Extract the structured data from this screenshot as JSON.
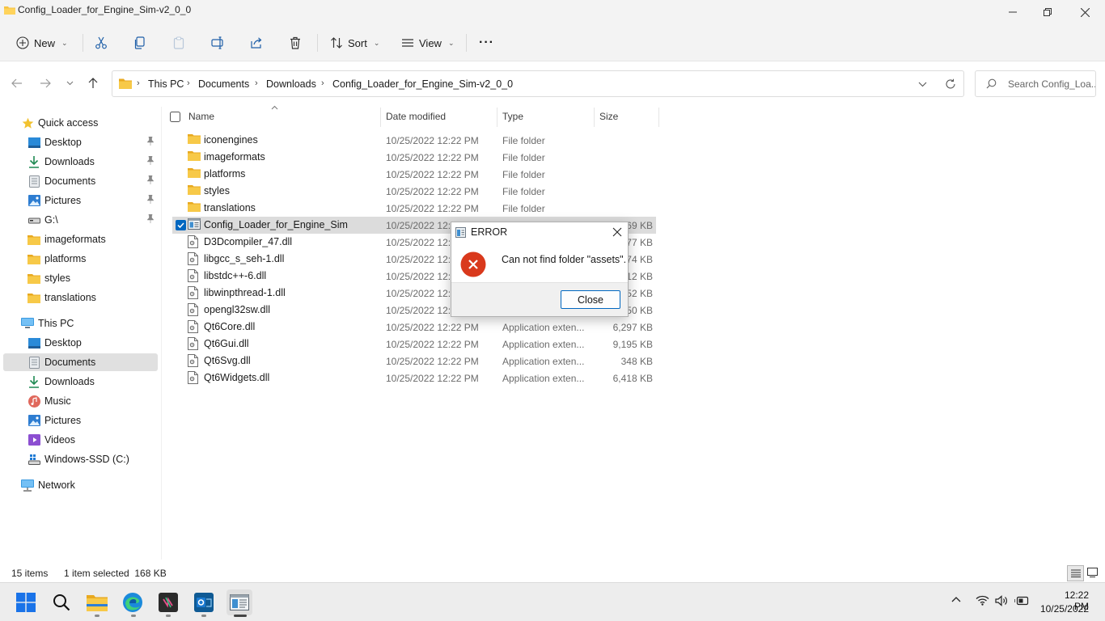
{
  "window": {
    "title": "Config_Loader_for_Engine_Sim-v2_0_0"
  },
  "toolbar": {
    "new_label": "New",
    "sort_label": "Sort",
    "view_label": "View",
    "more_label": "···"
  },
  "address": {
    "crumbs": [
      "This PC",
      "Documents",
      "Downloads",
      "Config_Loader_for_Engine_Sim-v2_0_0"
    ],
    "search_placeholder": "Search Config_Loa..."
  },
  "sidebar": {
    "quick_access": "Quick access",
    "quick_items": [
      {
        "label": "Desktop",
        "icon": "desktop-icon",
        "pinned": true
      },
      {
        "label": "Downloads",
        "icon": "download-icon",
        "pinned": true
      },
      {
        "label": "Documents",
        "icon": "document-icon",
        "pinned": true
      },
      {
        "label": "Pictures",
        "icon": "pictures-icon",
        "pinned": true
      },
      {
        "label": "G:\\",
        "icon": "drive-icon",
        "pinned": true
      },
      {
        "label": "imageformats",
        "icon": "folder-icon",
        "pinned": false
      },
      {
        "label": "platforms",
        "icon": "folder-icon",
        "pinned": false
      },
      {
        "label": "styles",
        "icon": "folder-icon",
        "pinned": false
      },
      {
        "label": "translations",
        "icon": "folder-icon",
        "pinned": false
      }
    ],
    "this_pc": "This PC",
    "pc_items": [
      {
        "label": "Desktop",
        "icon": "desktop-icon"
      },
      {
        "label": "Documents",
        "icon": "document-icon",
        "selected": true
      },
      {
        "label": "Downloads",
        "icon": "download-icon"
      },
      {
        "label": "Music",
        "icon": "music-icon"
      },
      {
        "label": "Pictures",
        "icon": "pictures-icon"
      },
      {
        "label": "Videos",
        "icon": "videos-icon"
      },
      {
        "label": "Windows-SSD (C:)",
        "icon": "drive-icon"
      }
    ],
    "network": "Network"
  },
  "columns": {
    "name": "Name",
    "date": "Date modified",
    "type": "Type",
    "size": "Size"
  },
  "files": [
    {
      "name": "iconengines",
      "date": "10/25/2022 12:22 PM",
      "type": "File folder",
      "size": "",
      "kind": "folder"
    },
    {
      "name": "imageformats",
      "date": "10/25/2022 12:22 PM",
      "type": "File folder",
      "size": "",
      "kind": "folder"
    },
    {
      "name": "platforms",
      "date": "10/25/2022 12:22 PM",
      "type": "File folder",
      "size": "",
      "kind": "folder"
    },
    {
      "name": "styles",
      "date": "10/25/2022 12:22 PM",
      "type": "File folder",
      "size": "",
      "kind": "folder"
    },
    {
      "name": "translations",
      "date": "10/25/2022 12:22 PM",
      "type": "File folder",
      "size": "",
      "kind": "folder"
    },
    {
      "name": "Config_Loader_for_Engine_Sim",
      "date": "10/25/2022 12:22 PM",
      "type": "Application",
      "size": "169 KB",
      "kind": "exe",
      "selected": true
    },
    {
      "name": "D3Dcompiler_47.dll",
      "date": "10/25/2022 12:22 PM",
      "type": "Application exten...",
      "size": "4,077 KB",
      "kind": "dll"
    },
    {
      "name": "libgcc_s_seh-1.dll",
      "date": "10/25/2022 12:22 PM",
      "type": "Application exten...",
      "size": "74 KB",
      "kind": "dll"
    },
    {
      "name": "libstdc++-6.dll",
      "date": "10/25/2022 12:22 PM",
      "type": "Application exten...",
      "size": "2,212 KB",
      "kind": "dll"
    },
    {
      "name": "libwinpthread-1.dll",
      "date": "10/25/2022 12:22 PM",
      "type": "Application exten...",
      "size": "52 KB",
      "kind": "dll"
    },
    {
      "name": "opengl32sw.dll",
      "date": "10/25/2022 12:22 PM",
      "type": "Application exten...",
      "size": "20,150 KB",
      "kind": "dll"
    },
    {
      "name": "Qt6Core.dll",
      "date": "10/25/2022 12:22 PM",
      "type": "Application exten...",
      "size": "6,297 KB",
      "kind": "dll"
    },
    {
      "name": "Qt6Gui.dll",
      "date": "10/25/2022 12:22 PM",
      "type": "Application exten...",
      "size": "9,195 KB",
      "kind": "dll"
    },
    {
      "name": "Qt6Svg.dll",
      "date": "10/25/2022 12:22 PM",
      "type": "Application exten...",
      "size": "348 KB",
      "kind": "dll"
    },
    {
      "name": "Qt6Widgets.dll",
      "date": "10/25/2022 12:22 PM",
      "type": "Application exten...",
      "size": "6,418 KB",
      "kind": "dll"
    }
  ],
  "status": {
    "items": "15 items",
    "selection": "1 item selected  168 KB"
  },
  "dialog": {
    "title": "ERROR",
    "message": "Can not find folder \"assets\".",
    "close_label": "Close"
  },
  "taskbar": {
    "time": "12:22 PM",
    "date": "10/25/2022"
  },
  "colors": {
    "accent": "#0067c0",
    "folder": "#f5c342",
    "error": "#d9391c"
  }
}
